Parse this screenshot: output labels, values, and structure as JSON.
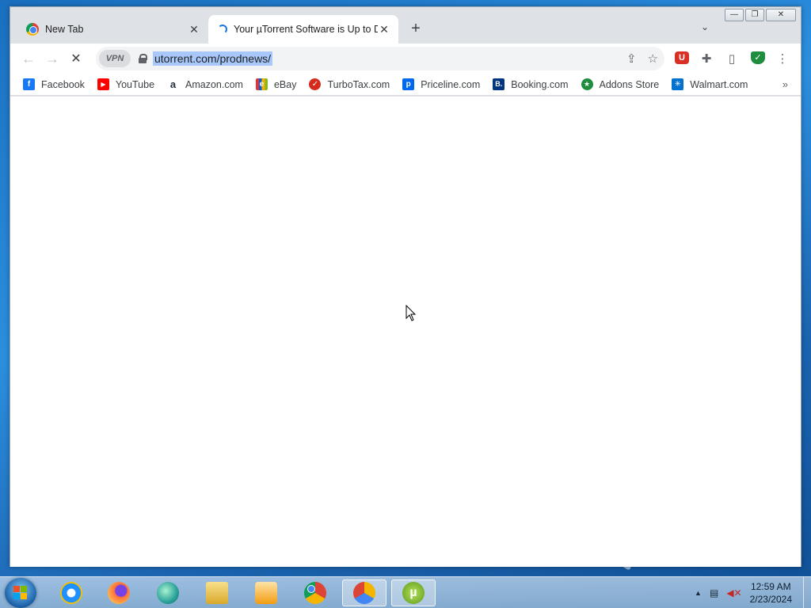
{
  "browser": {
    "tabs": [
      {
        "title": "New Tab",
        "active": false
      },
      {
        "title": "Your µTorrent Software is Up to D",
        "active": true
      }
    ],
    "new_tab_label": "+",
    "tab_search_label": "⌄",
    "window_controls": {
      "minimize": "—",
      "restore": "❐",
      "close": "✕"
    },
    "toolbar": {
      "back": "←",
      "forward": "→",
      "stop": "✕",
      "vpn_label": "VPN",
      "url": "utorrent.com/prodnews/",
      "share_icon": "⇪",
      "star_icon": "☆"
    },
    "extensions": {
      "adblock": "U",
      "puzzle": "✚",
      "sidepanel": "▯",
      "shield": "✓",
      "menu": "⋮"
    },
    "bookmarks": [
      {
        "label": "Facebook",
        "icon": "f",
        "color": "#1877f2"
      },
      {
        "label": "YouTube",
        "icon": "▶",
        "color": "#ff0000"
      },
      {
        "label": "Amazon.com",
        "icon": "a",
        "color": "#232f3e"
      },
      {
        "label": "eBay",
        "icon": "e",
        "color": "#e53238"
      },
      {
        "label": "TurboTax.com",
        "icon": "✓",
        "color": "#d52b1e"
      },
      {
        "label": "Priceline.com",
        "icon": "p",
        "color": "#0068ef"
      },
      {
        "label": "Booking.com",
        "icon": "B.",
        "color": "#003580"
      },
      {
        "label": "Addons Store",
        "icon": "★",
        "color": "#1e8e3e"
      },
      {
        "label": "Walmart.com",
        "icon": "✳",
        "color": "#0071ce"
      }
    ],
    "bookmarks_more": "»"
  },
  "taskbar": {
    "apps": [
      {
        "name": "internet-explorer",
        "color": "#1e90ff"
      },
      {
        "name": "firefox",
        "color": "#ff7139"
      },
      {
        "name": "app-green",
        "color": "#2aa198"
      },
      {
        "name": "file-explorer",
        "color": "#e8c25a"
      },
      {
        "name": "media-player",
        "color": "#f39c12"
      },
      {
        "name": "chrome",
        "color": "#db4437"
      },
      {
        "name": "vpn-app",
        "color": "#f4b400"
      },
      {
        "name": "utorrent",
        "color": "#78b82a"
      }
    ],
    "tray_arrow": "▲",
    "clock_time": "12:59 AM",
    "clock_date": "2/23/2024"
  }
}
